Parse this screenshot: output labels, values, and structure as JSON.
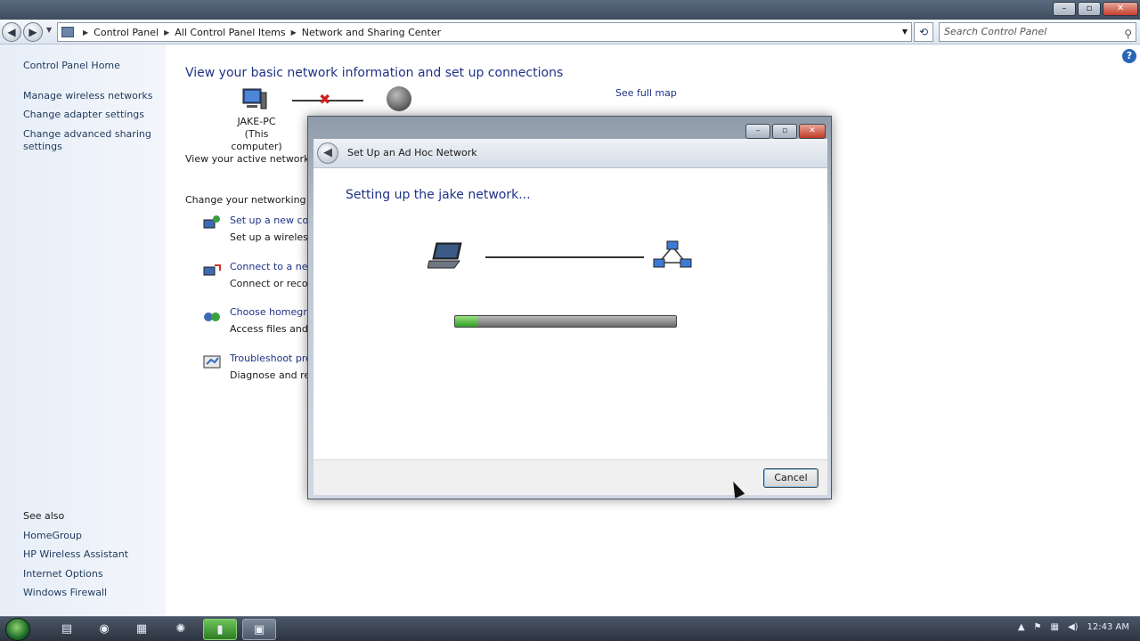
{
  "window": {
    "minimize": "–",
    "maximize": "▫",
    "close": "✕"
  },
  "address_bar": {
    "crumbs": [
      "Control Panel",
      "All Control Panel Items",
      "Network and Sharing Center"
    ],
    "search_placeholder": "Search Control Panel"
  },
  "left_pane": {
    "home": "Control Panel Home",
    "links": [
      "Manage wireless networks",
      "Change adapter settings",
      "Change advanced sharing settings"
    ],
    "see_also_heading": "See also",
    "see_also": [
      "HomeGroup",
      "HP Wireless Assistant",
      "Internet Options",
      "Windows Firewall"
    ]
  },
  "main": {
    "title": "View your basic network information and set up connections",
    "see_full_map": "See full map",
    "computer_name": "JAKE-PC",
    "computer_caption": "(This computer)",
    "active_networks": "View your active networks",
    "change_settings": "Change your networking se",
    "tasks": [
      {
        "title": "Set up a new con",
        "desc": "Set up a wireless,"
      },
      {
        "title": "Connect to a netw",
        "desc": "Connect or recon"
      },
      {
        "title": "Choose homegro",
        "desc": "Access files and p"
      },
      {
        "title": "Troubleshoot pro",
        "desc": "Diagnose and rep"
      }
    ]
  },
  "dialog": {
    "title": "Set Up an Ad Hoc Network",
    "message": "Setting up the jake network...",
    "progress": 0.1,
    "cancel": "Cancel"
  },
  "taskbar": {
    "clock": "12:43 AM"
  },
  "icons": {
    "back": "back-arrow-icon",
    "forward": "forward-arrow-icon",
    "search": "search-icon",
    "help": "help-icon"
  },
  "colors": {
    "link": "#1e3287",
    "left_pane": "#e7eef8",
    "progress_fill": "#2f9e27",
    "error_x": "#cc1f1f"
  }
}
